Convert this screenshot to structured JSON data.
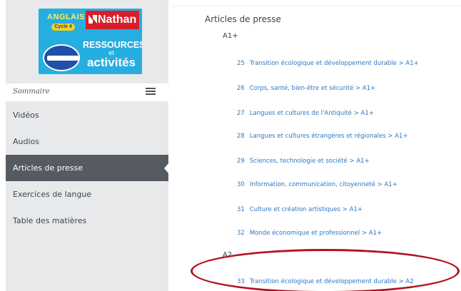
{
  "cover": {
    "anglais": "ANGLAIS",
    "cycle": "Cycle 4",
    "publisher": "Nathan",
    "ressources": "RESSOURCES",
    "et": "et",
    "activites": "activités"
  },
  "sidebar": {
    "sommaire_label": "Sommaire",
    "items": [
      {
        "label": "Vidéos",
        "active": false
      },
      {
        "label": "Audios",
        "active": false
      },
      {
        "label": "Articles de presse",
        "active": true
      },
      {
        "label": "Exercices de langue",
        "active": false
      },
      {
        "label": "Table des matières",
        "active": false
      }
    ]
  },
  "main": {
    "section_title": "Articles de presse",
    "levels": [
      {
        "label": "A1+",
        "articles": [
          {
            "num": "25",
            "title": "Transition écologique et développement durable > A1+"
          },
          {
            "num": "26",
            "title": "Corps, santé, bien-être et sécurité > A1+"
          },
          {
            "num": "27",
            "title": "Langues et cultures de l'Antiquité > A1+"
          },
          {
            "num": "28",
            "title": "Langues et cultures étrangères et régionales > A1+"
          },
          {
            "num": "29",
            "title": "Sciences, technologie et société > A1+"
          },
          {
            "num": "30",
            "title": "Information, communication, citoyenneté > A1+"
          },
          {
            "num": "31",
            "title": "Culture et création artistiques > A1+"
          },
          {
            "num": "32",
            "title": "Monde économique et professionnel > A1+"
          }
        ]
      },
      {
        "label": "A2",
        "articles": [
          {
            "num": "33",
            "title": "Transition écologique et développement durable > A2"
          }
        ]
      }
    ]
  },
  "colors": {
    "sidebar_bg": "#e8e9eb",
    "active_item_bg": "#565b62",
    "link": "#2b78c4",
    "highlight": "#b3121d",
    "cover_bg": "#27aee0"
  }
}
